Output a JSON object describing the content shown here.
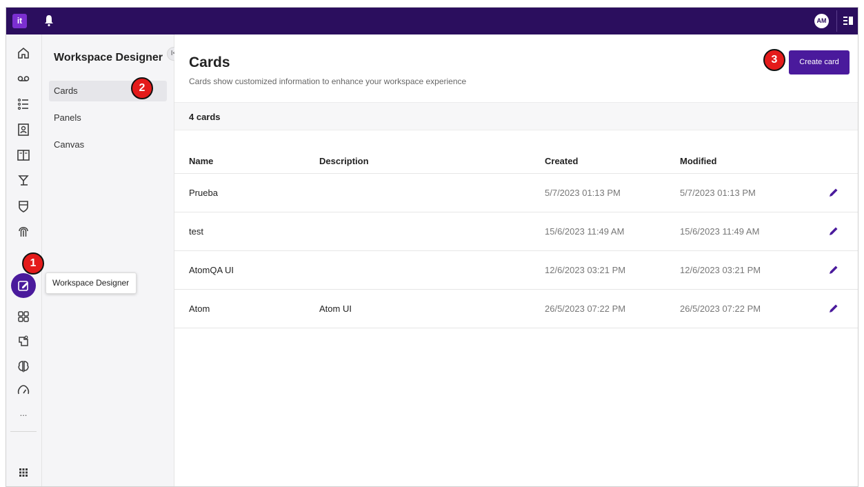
{
  "topbar": {
    "logo": "it",
    "avatar_initials": "AM"
  },
  "rail": {
    "icons": [
      "home-icon",
      "voicemail-icon",
      "list-icon",
      "contact-card-icon",
      "book-icon",
      "flow-icon",
      "shield-icon",
      "fingerprint-icon",
      "workspace-designer-icon",
      "grid-icon",
      "bot-icon",
      "brain-icon",
      "gauge-icon",
      "more-icon",
      "apps-icon"
    ],
    "more_label": "...",
    "tooltip": "Workspace Designer"
  },
  "subnav": {
    "title": "Workspace Designer",
    "collapse_label": "I<",
    "items": [
      {
        "label": "Cards",
        "active": true
      },
      {
        "label": "Panels",
        "active": false
      },
      {
        "label": "Canvas",
        "active": false
      }
    ]
  },
  "main": {
    "title": "Cards",
    "subtitle": "Cards show customized information to enhance your workspace experience",
    "create_label": "Create card",
    "count": "4 cards",
    "columns": [
      "Name",
      "Description",
      "Created",
      "Modified"
    ],
    "rows": [
      {
        "name": "Prueba",
        "description": "",
        "created": "5/7/2023 01:13 PM",
        "modified": "5/7/2023 01:13 PM"
      },
      {
        "name": "test",
        "description": "",
        "created": "15/6/2023 11:49 AM",
        "modified": "15/6/2023 11:49 AM"
      },
      {
        "name": "AtomQA UI",
        "description": "",
        "created": "12/6/2023 03:21 PM",
        "modified": "12/6/2023 03:21 PM"
      },
      {
        "name": "Atom",
        "description": "Atom UI",
        "created": "26/5/2023 07:22 PM",
        "modified": "26/5/2023 07:22 PM"
      }
    ]
  },
  "callouts": [
    "1",
    "2",
    "3"
  ],
  "colors": {
    "topbar": "#2b0e5e",
    "accent": "#4a1a9c",
    "badge": "#e41b1b"
  }
}
